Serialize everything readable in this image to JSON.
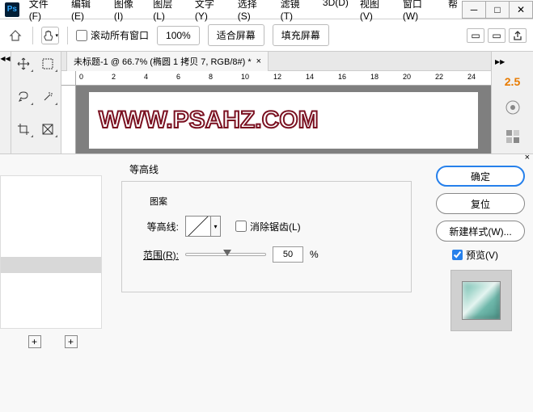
{
  "menu": {
    "items": [
      "文件(F)",
      "编辑(E)",
      "图像(I)",
      "图层(L)",
      "文字(Y)",
      "选择(S)",
      "滤镜(T)",
      "3D(D)",
      "视图(V)",
      "窗口(W)",
      "帮"
    ]
  },
  "options": {
    "scroll_all_label": "滚动所有窗口",
    "zoom": "100%",
    "fit_screen": "适合屏幕",
    "fill_screen": "填充屏幕"
  },
  "document": {
    "tab_title": "未标题-1 @ 66.7% (椭圆 1 拷贝 7, RGB/8#) *",
    "ruler_marks": [
      "0",
      "2",
      "4",
      "6",
      "8",
      "10",
      "12",
      "14",
      "16",
      "18",
      "20",
      "22",
      "24"
    ],
    "watermark": "WWW.PSAHZ.COM"
  },
  "right_panel": {
    "value": "2.5"
  },
  "dialog": {
    "section_title": "等高线",
    "legend": "图案",
    "contour_label": "等高线:",
    "antialias_label": "消除锯齿(L)",
    "range_label": "范围(R):",
    "range_value": "50",
    "range_unit": "%",
    "ok": "确定",
    "reset": "复位",
    "new_style": "新建样式(W)...",
    "preview": "预览(V)"
  }
}
